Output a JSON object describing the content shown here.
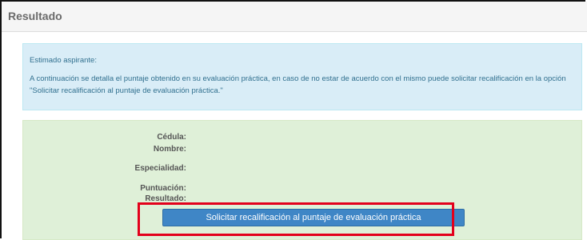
{
  "panel": {
    "title": "Resultado"
  },
  "info": {
    "greeting": "Estimado aspirante:",
    "message": "A continuación se detalla el puntaje obtenido en su evaluación práctica, en caso de no estar de acuerdo con el mismo puede solicitar recalificación en la opción \"Solicitar recalificación al puntaje de evaluación práctica.\""
  },
  "result": {
    "labels": {
      "cedula": "Cédula:",
      "nombre": "Nombre:",
      "especialidad": "Especialidad:",
      "puntuacion": "Puntuación:",
      "resultado": "Resultado:"
    },
    "values": {
      "cedula": "",
      "nombre": "",
      "especialidad": "",
      "puntuacion": "",
      "resultado": ""
    },
    "button_label": "Solicitar recalificación al puntaje de evaluación práctica"
  },
  "colors": {
    "info_bg": "#d9edf7",
    "result_bg": "#dff0d8",
    "button_bg": "#3f86c6",
    "highlight": "#e3001b"
  }
}
